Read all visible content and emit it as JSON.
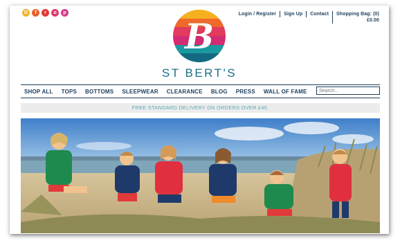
{
  "social": [
    {
      "icon": "google-plus-icon",
      "glyph": "G",
      "color": "#f0b529"
    },
    {
      "icon": "facebook-icon",
      "glyph": "f",
      "color": "#e8622b"
    },
    {
      "icon": "rss-icon",
      "glyph": "r",
      "color": "#e03a3a"
    },
    {
      "icon": "instagram-icon",
      "glyph": "o",
      "color": "#e03a6d"
    },
    {
      "icon": "pinterest-icon",
      "glyph": "p",
      "color": "#d43a86"
    }
  ],
  "toplinks": {
    "login": "Login / Register",
    "signup": "Sign Up",
    "contact": "Contact",
    "bag": "Shopping Bag: (0)",
    "bag_total": "£0.00"
  },
  "brand": {
    "name": "ST BERT'S",
    "monogram": "B",
    "logo_colors": [
      "#f6b01e",
      "#ef6a2a",
      "#e33b5d",
      "#d42c73",
      "#1a9aa0",
      "#136a80"
    ]
  },
  "nav": {
    "items": [
      "SHOP ALL",
      "TOPS",
      "BOTTOMS",
      "SLEEPWEAR",
      "CLEARANCE",
      "BLOG",
      "PRESS",
      "WALL OF FAME"
    ],
    "search_placeholder": "Search..."
  },
  "delivery_text": "FREE STANDARD DELIVERY ON ORDERS OVER £40.",
  "colors": {
    "navy": "#1a3e5c",
    "teal": "#1a6f86",
    "delivery_text": "#5aa9b3"
  }
}
